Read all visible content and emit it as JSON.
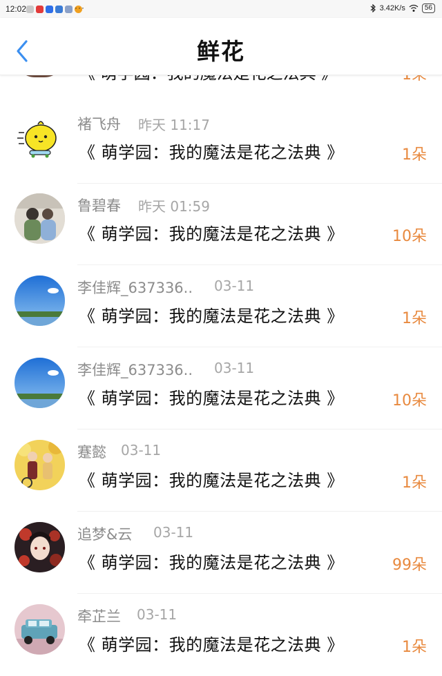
{
  "status_bar": {
    "time": "12:02",
    "dots": "···",
    "speed": "3.42K/s",
    "battery": "56"
  },
  "header": {
    "title": "鲜花"
  },
  "partial_row": {
    "book": "《 萌学园：我的魔法是花之法典 》",
    "count": "1朵"
  },
  "rows": [
    {
      "name": "褚飞舟",
      "time": "昨天 11:17",
      "book": "《 萌学园：我的魔法是花之法典 》",
      "count": "1朵",
      "avatar": "yellow-chick-avatar"
    },
    {
      "name": "鲁碧春",
      "time": "昨天 01:59",
      "book": "《 萌学园：我的魔法是花之法典 》",
      "count": "10朵",
      "avatar": "couple-photo-avatar"
    },
    {
      "name": "李佳辉_637336..",
      "time": "03-11",
      "book": "《 萌学园：我的魔法是花之法典 》",
      "count": "1朵",
      "avatar": "sky-landscape-avatar"
    },
    {
      "name": "李佳辉_637336..",
      "time": "03-11",
      "book": "《 萌学园：我的魔法是花之法典 》",
      "count": "10朵",
      "avatar": "sky-landscape-avatar"
    },
    {
      "name": "蹇懿",
      "time": "03-11",
      "book": "《 萌学园：我的魔法是花之法典 》",
      "count": "1朵",
      "avatar": "anime-couple-avatar"
    },
    {
      "name": "追梦&云",
      "time": "03-11",
      "book": "《 萌学园：我的魔法是花之法典 》",
      "count": "99朵",
      "avatar": "anime-girl-avatar"
    },
    {
      "name": "牵芷兰",
      "time": "03-11",
      "book": "《 萌学园：我的魔法是花之法典 》",
      "count": "1朵",
      "avatar": "blue-car-avatar"
    }
  ]
}
